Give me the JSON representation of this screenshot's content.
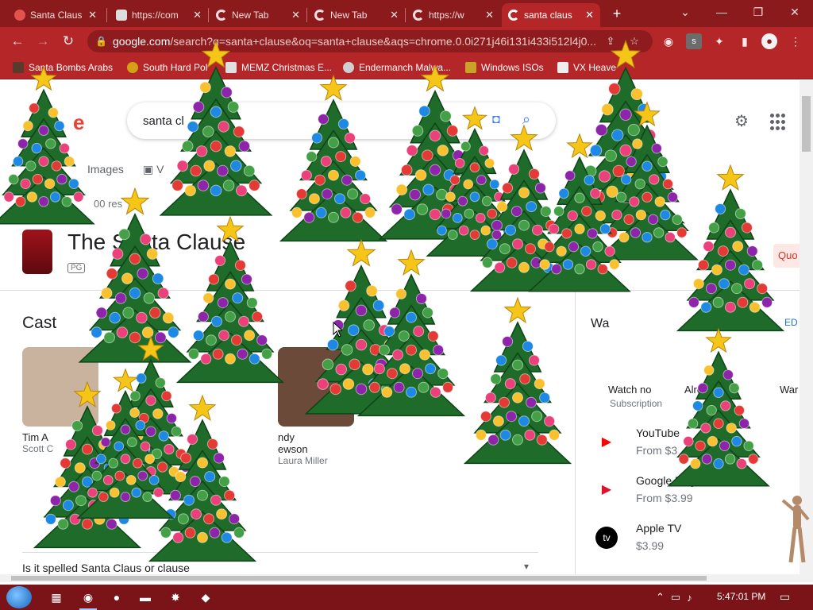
{
  "browser": {
    "tabs": [
      {
        "title": "Santa Claus",
        "favicon": "red-icon",
        "active": false
      },
      {
        "title": "https://com",
        "favicon": "skull-icon",
        "active": false
      },
      {
        "title": "New Tab",
        "favicon": "chrome-icon",
        "active": false
      },
      {
        "title": "New Tab",
        "favicon": "chrome-icon",
        "active": false
      },
      {
        "title": "https://w",
        "favicon": "google-icon",
        "active": false
      },
      {
        "title": "santa claus",
        "favicon": "google-icon",
        "active": true
      }
    ],
    "new_tab": "+",
    "window_controls": {
      "tab_search": "⌄",
      "minimize": "—",
      "maximize": "❐",
      "close": "✕"
    },
    "url": {
      "host": "google.com",
      "rest": "/search?q=santa+clause&oq=santa+clause&aqs=chrome.0.0i271j46i131i433i512l4j0..."
    },
    "bookmarks": [
      "Santa Bombs Arabs",
      "South Hard Pol",
      "MEMZ Christmas E...",
      "Endermanch Malwa...",
      "Windows ISOs",
      "VX Heave"
    ]
  },
  "google": {
    "logo_fragment": "e",
    "search_value": "santa cl",
    "tabs": [
      "Images",
      "V"
    ],
    "result_stats": "00 res",
    "knowledge_panel": {
      "title": "The Santa Clause",
      "rating": "PG",
      "quote_chip": "Quo",
      "cast_heading": "Cast",
      "cast": [
        {
          "name": "Tim A",
          "role": "Scott C"
        },
        {
          "name": "ndy",
          "role": "Laura Miller",
          "name2": "ewson"
        }
      ],
      "faq": "Is it spelled Santa Claus or clause"
    },
    "watch": {
      "heading": "Wa",
      "ed_link": "ED",
      "options": [
        "Watch no",
        "Alrea",
        "War"
      ],
      "subscription": "Subscription",
      "providers": [
        {
          "name": "YouTube",
          "price": "From $3",
          "logo": "youtube-icon",
          "color": "#ff0000"
        },
        {
          "name": "Google Play Movies",
          "price": "From $3.99",
          "logo": "google-play-icon",
          "color": "#e1122a"
        },
        {
          "name": "Apple TV",
          "price": "$3.99",
          "logo": "apple-tv-icon",
          "color": "#000000"
        }
      ]
    }
  },
  "taskbar": {
    "apps": [
      "chrome-icon",
      "firefox-icon",
      "file-explorer-icon",
      "malware-icon",
      "app-icon"
    ],
    "clock": "5:47:01 PM"
  },
  "colors": {
    "theme_dark": "#8b1a1d",
    "theme_mid": "#b42628",
    "tree_green": "#1f6b2a",
    "ornament_colors": [
      "#e53935",
      "#fbc02d",
      "#8e24aa",
      "#1e88e5",
      "#43a047",
      "#ec407a"
    ]
  }
}
